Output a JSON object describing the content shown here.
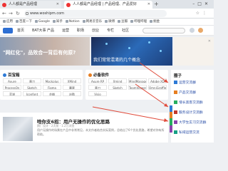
{
  "browser": {
    "tabs": [
      {
        "label": "人人都是产品经理",
        "active": false
      },
      {
        "label": "人人都是产品经理 | 产品经理、产品爱好",
        "active": true
      }
    ],
    "url": "www.woshipm.com",
    "bookmarks": [
      "应用",
      "百度一下",
      "Google",
      "知乎",
      "Notion",
      "网易云音乐",
      "微博",
      "豆瓣",
      "哔哩哔哩",
      "掘金"
    ]
  },
  "site_nav": {
    "items": [
      "首页",
      "BAT大事",
      "产品",
      "运营",
      "职场",
      "创业",
      "专栏",
      "社区"
    ]
  },
  "banners": {
    "left_title": "\"网红化\"，品效合一背后有何原? ",
    "right_title": "我们常常混淆的几个概念"
  },
  "cards": {
    "baike": {
      "title": "百宝箱",
      "cells": [
        "Axure",
        "墨刀",
        "Mockplus",
        "XMind",
        "ProcessOn",
        "Sketch",
        "Figma",
        "摹客",
        "蓝湖",
        "Iconfont",
        "花瓣",
        "站酷"
      ]
    },
    "tools": {
      "title": "必备软件",
      "cells": [
        "Axure RP",
        "Xmind",
        "MindManager",
        "Adobe XD",
        "墨刀",
        "Sketch",
        "TeamViewer",
        "OmniGraffle",
        "Visio"
      ]
    }
  },
  "right_panel": {
    "title": "圈子",
    "items": [
      {
        "label": "运营交流群",
        "color": "#2d7ad6"
      },
      {
        "label": "产品交流群",
        "color": "#e67e22"
      },
      {
        "label": "增长黑客交流群",
        "color": "#27ae60"
      },
      {
        "label": "服务设计交流群",
        "color": "#c0392b"
      },
      {
        "label": "大学生实习交流群",
        "color": "#8e44ad"
      },
      {
        "label": "私域运营交流",
        "color": "#16a085"
      }
    ]
  },
  "article": {
    "title": "啥你支6招：用户无操作的优化思路",
    "meta": "鹅厂设计 · 2天前 · 1.2万浏览",
    "excerpt": "用户无操作的场景在产品中非常常见，本文作者结合实际案例，总结出了6个优化思路，希望对你有所帮助。"
  },
  "colors": {
    "accent": "#2d6fd3",
    "arrow": "#e04a3a"
  }
}
